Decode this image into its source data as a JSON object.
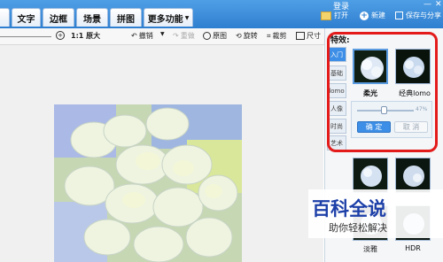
{
  "menubar": {
    "tabs": [
      "",
      "文字",
      "边框",
      "场景",
      "拼图",
      "更多功能"
    ],
    "title_fragment": "登录",
    "open_label": "打开",
    "new_label": "新建",
    "save_label": "保存与分享"
  },
  "toolbar": {
    "zoom_label": "1:1 原大",
    "undo_label": "撤销",
    "redo_label": "重做",
    "original_label": "原图",
    "rotate_label": "旋转",
    "crop_label": "裁剪",
    "size_label": "尺寸"
  },
  "effects": {
    "title": "特效:",
    "side_tabs": [
      "入门",
      "基础",
      "lomo",
      "人像",
      "时尚",
      "艺术"
    ],
    "presets": [
      {
        "label": "柔光"
      },
      {
        "label": "经典lomo"
      }
    ],
    "bottom_presets": [
      {
        "label": "淡雅"
      },
      {
        "label": "HDR"
      }
    ],
    "slider": {
      "value_text": "47%",
      "fraction": 0.47
    },
    "confirm_label": "确 定",
    "cancel_label": "取 消"
  },
  "watermark": {
    "logo": "百科全说",
    "subtitle": "助你轻松解决"
  }
}
